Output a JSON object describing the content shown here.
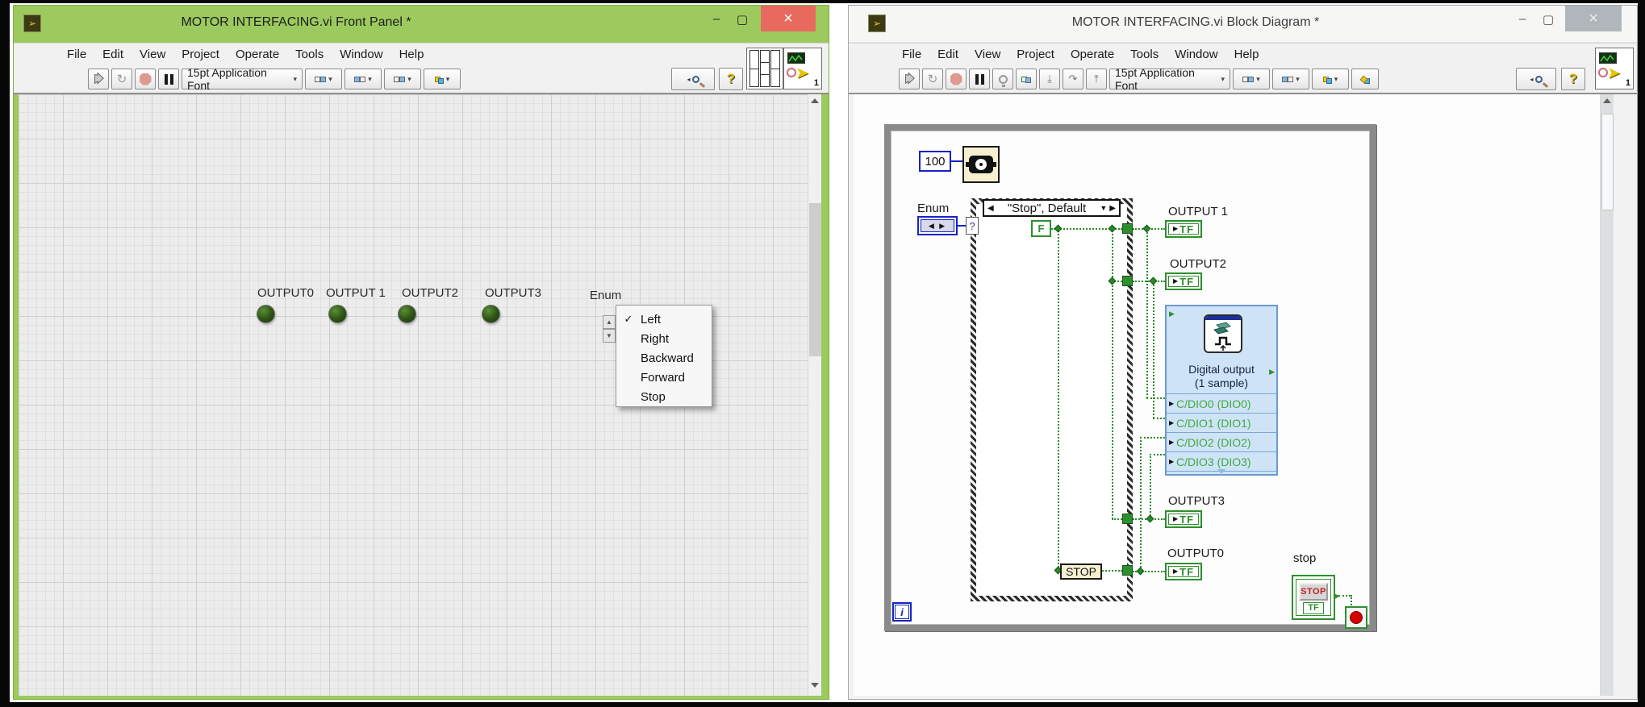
{
  "menus": [
    "File",
    "Edit",
    "View",
    "Project",
    "Operate",
    "Tools",
    "Window",
    "Help"
  ],
  "glyphs": {
    "check": "✓",
    "dropdown_caret": "▾",
    "sel_left": "◀",
    "sel_right": "▶",
    "sel_down": "▼",
    "enum_term": "◀ ▶",
    "minimize": "–",
    "close": "×",
    "run_continuous": "↻",
    "step_into": "⤓",
    "step_over": "↷",
    "step_out": "⤒",
    "search_tick": "◂"
  },
  "left_window": {
    "title": "MOTOR INTERFACING.vi Front Panel *",
    "toolbar": {
      "font": "15pt Application Font"
    },
    "vi_badge": "1",
    "front_panel": {
      "led_labels": [
        "OUTPUT0",
        "OUTPUT 1",
        "OUTPUT2",
        "OUTPUT3"
      ],
      "enum": {
        "label": "Enum",
        "items": [
          "Left",
          "Right",
          "Backward",
          "Forward",
          "Stop"
        ],
        "selected_index": 0
      }
    }
  },
  "right_window": {
    "title": "MOTOR INTERFACING.vi Block Diagram *",
    "toolbar": {
      "font": "15pt Application Font"
    },
    "vi_badge": "1",
    "diagram": {
      "wait_ms": "100",
      "enum_label": "Enum",
      "case": {
        "selector": "\"Stop\", Default",
        "question": "?"
      },
      "false_const": "F",
      "terminal_labels": [
        "OUTPUT 1",
        "OUTPUT2",
        "OUTPUT3",
        "OUTPUT0"
      ],
      "tf": "TF",
      "express": {
        "title": "Digital output",
        "subtitle": "(1 sample)",
        "channels": [
          "C/DIO0 (DIO0)",
          "C/DIO1 (DIO1)",
          "C/DIO2 (DIO2)",
          "C/DIO3 (DIO3)"
        ]
      },
      "wire_label": "STOP",
      "stop_button": {
        "label": "stop",
        "face": "STOP",
        "tf": "TF"
      },
      "iteration": "i"
    }
  },
  "colors": {
    "active_titlebar": "#9dca5e",
    "boolean_wire": "#2a8a2a",
    "numeric_wire": "#1622c8",
    "express_bg": "#cfe3f7",
    "abort_red": "#dd9a92",
    "close_button_red": "#e8695e",
    "led_green": "#2c5214"
  }
}
